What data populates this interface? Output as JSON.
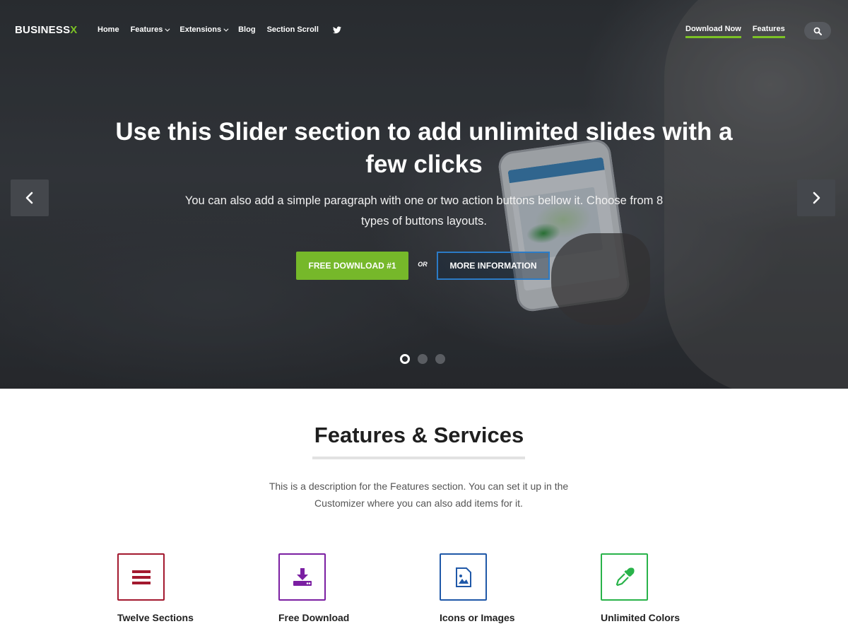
{
  "nav": {
    "logo_main": "BUSINESS",
    "logo_accent": "X",
    "items": [
      {
        "label": "Home"
      },
      {
        "label": "Features"
      },
      {
        "label": "Extensions"
      },
      {
        "label": "Blog"
      },
      {
        "label": "Section Scroll"
      }
    ],
    "right_links": [
      {
        "label": "Download Now"
      },
      {
        "label": "Features"
      }
    ],
    "icons": {
      "twitter": "twitter-icon",
      "search": "search-icon"
    }
  },
  "hero": {
    "title": "Use this Slider section to add unlimited slides with a few clicks",
    "text": "You can also add a simple paragraph with one or two action buttons bellow it. Choose from 8 types of buttons layouts.",
    "primary_button": "FREE DOWNLOAD #1",
    "or_label": "OR",
    "secondary_button": "MORE INFORMATION",
    "slides": 3,
    "active_slide": 1
  },
  "features": {
    "title": "Features & Services",
    "description": "This is a description for the Features section. You can set it up in the Customizer where you can also add items for it.",
    "items": [
      {
        "label": "Twelve Sections",
        "icon": "list-icon",
        "color": "#a3192f"
      },
      {
        "label": "Free Download",
        "icon": "download-icon",
        "color": "#7b1fa2"
      },
      {
        "label": "Icons or Images",
        "icon": "image-icon",
        "color": "#1f58a8"
      },
      {
        "label": "Unlimited Colors",
        "icon": "eyedropper-icon",
        "color": "#29b34a"
      }
    ]
  },
  "colors": {
    "accent_green": "#7cc225",
    "button_green": "#76b82a",
    "button_blue_border": "#2b7bc6"
  }
}
